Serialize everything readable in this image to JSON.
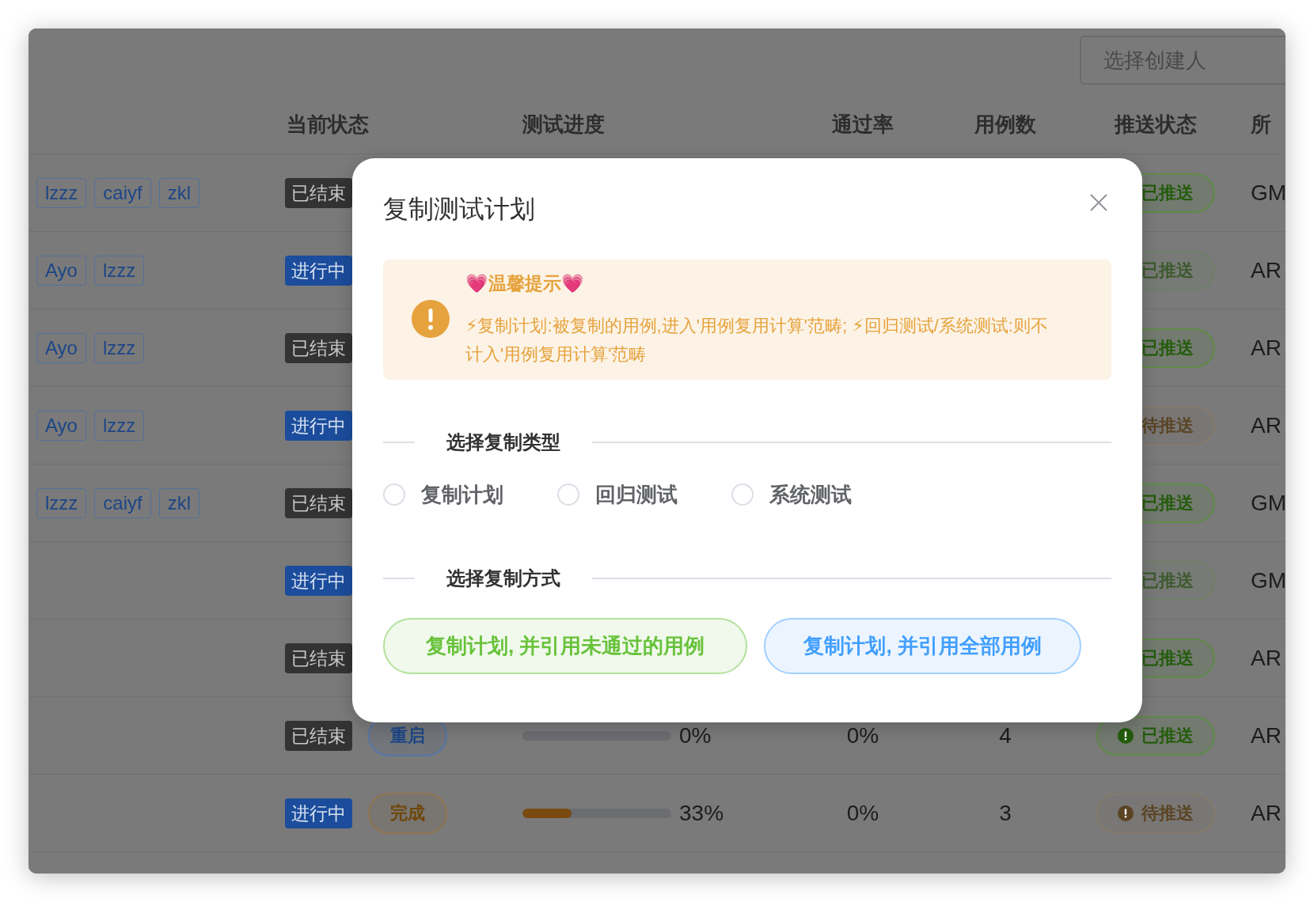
{
  "search": {
    "placeholder": "选择创建人"
  },
  "table": {
    "columns": [
      "当前状态",
      "测试进度",
      "通过率",
      "用例数",
      "推送状态",
      "所"
    ],
    "rows": [
      {
        "members": [
          "lzzz",
          "caiyf",
          "zkl"
        ],
        "status": {
          "label": "已结束",
          "kind": "ended"
        },
        "push": {
          "label": "已推送",
          "kind": "done",
          "disabled": false
        },
        "project": "GM"
      },
      {
        "members": [
          "Ayo",
          "lzzz"
        ],
        "status": {
          "label": "进行中",
          "kind": "running"
        },
        "push": {
          "label": "已推送",
          "kind": "done",
          "disabled": true
        },
        "project": "AR"
      },
      {
        "members": [
          "Ayo",
          "lzzz"
        ],
        "status": {
          "label": "已结束",
          "kind": "ended"
        },
        "push": {
          "label": "已推送",
          "kind": "done",
          "disabled": false
        },
        "project": "AR"
      },
      {
        "members": [
          "Ayo",
          "lzzz"
        ],
        "status": {
          "label": "进行中",
          "kind": "running"
        },
        "push": {
          "label": "待推送",
          "kind": "pending",
          "disabled": true
        },
        "project": "AR"
      },
      {
        "members": [
          "lzzz",
          "caiyf",
          "zkl"
        ],
        "status": {
          "label": "已结束",
          "kind": "ended"
        },
        "push": {
          "label": "已推送",
          "kind": "done",
          "disabled": false
        },
        "project": "GM"
      },
      {
        "members": [],
        "status": {
          "label": "进行中",
          "kind": "running"
        },
        "push": {
          "label": "已推送",
          "kind": "done",
          "disabled": true
        },
        "project": "GM"
      },
      {
        "members": [],
        "status": {
          "label": "已结束",
          "kind": "ended"
        },
        "push": {
          "label": "已推送",
          "kind": "done",
          "disabled": false
        },
        "project": "AR"
      },
      {
        "members": [],
        "status": {
          "label": "已结束",
          "kind": "ended"
        },
        "action": {
          "label": "重启",
          "kind": "restart"
        },
        "progress": {
          "level": 0,
          "reading": "0%"
        },
        "pass_rate": "0%",
        "cases": "4",
        "push": {
          "label": "已推送",
          "kind": "done",
          "disabled": false
        },
        "project": "AR"
      },
      {
        "members": [],
        "status": {
          "label": "进行中",
          "kind": "running"
        },
        "action": {
          "label": "完成",
          "kind": "finish"
        },
        "progress": {
          "level": 0.33,
          "reading": "33%"
        },
        "pass_rate": "0%",
        "cases": "3",
        "push": {
          "label": "待推送",
          "kind": "pending",
          "disabled": true
        },
        "project": "AR"
      }
    ]
  },
  "dialog": {
    "title": "复制测试计划",
    "alert": {
      "title": "💗温馨提示💗",
      "text": "⚡复制计划:被复制的用例,进入'用例复用计算'范畴; ⚡回归测试/系统测试:则不计入'用例复用计算'范畴"
    },
    "type_section": {
      "title": "选择复制类型",
      "options": [
        {
          "label": "复制计划",
          "selected": false
        },
        {
          "label": "回归测试",
          "selected": false
        },
        {
          "label": "系统测试",
          "selected": false
        }
      ]
    },
    "mode_section": {
      "title": "选择复制方式",
      "buttons": [
        {
          "label": "复制计划, 并引用未通过的用例",
          "kind": "success"
        },
        {
          "label": "复制计划, 并引用全部用例",
          "kind": "primary"
        }
      ]
    }
  }
}
